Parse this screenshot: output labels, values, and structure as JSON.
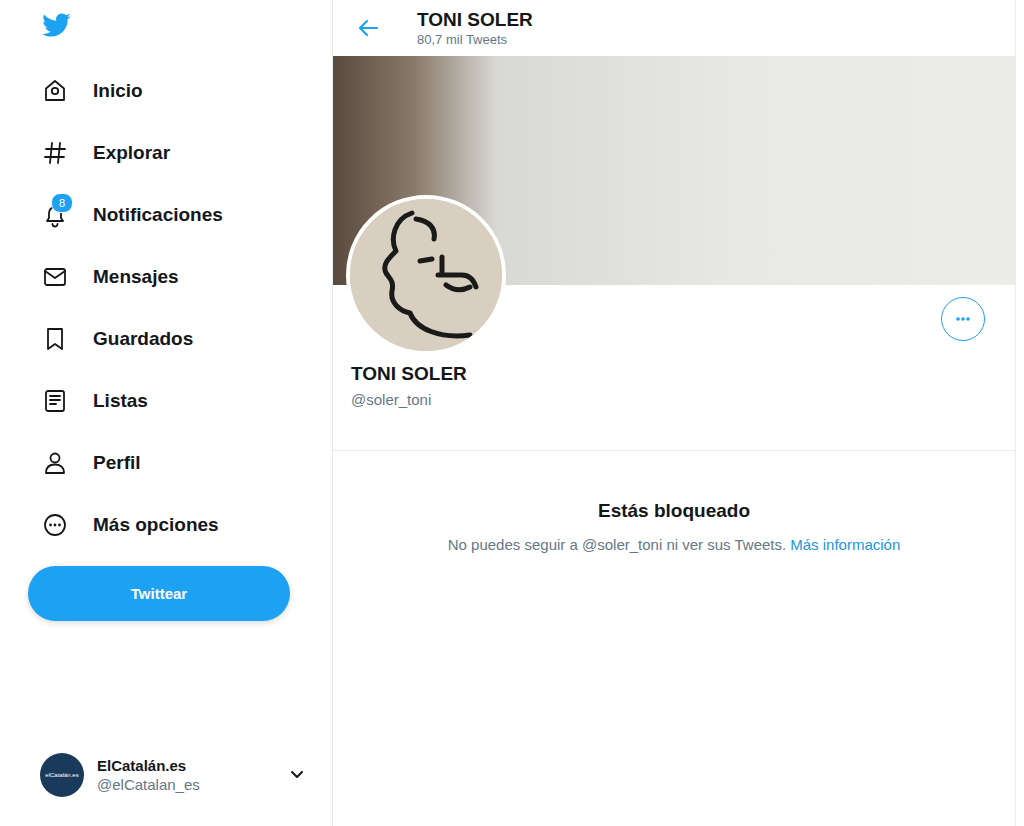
{
  "sidebar": {
    "items": [
      {
        "label": "Inicio"
      },
      {
        "label": "Explorar"
      },
      {
        "label": "Notificaciones",
        "badge": "8"
      },
      {
        "label": "Mensajes"
      },
      {
        "label": "Guardados"
      },
      {
        "label": "Listas"
      },
      {
        "label": "Perfil"
      },
      {
        "label": "Más opciones"
      }
    ],
    "tweet_button": "Twittear",
    "account": {
      "avatar_text": "elCatalán.es",
      "name": "ElCatalán.es",
      "handle": "@elCatalan_es"
    }
  },
  "header": {
    "name": "TONI SOLER",
    "tweet_count": "80,7 mil Tweets"
  },
  "profile": {
    "name": "TONI SOLER",
    "handle": "@soler_toni"
  },
  "blocked": {
    "title": "Estás bloqueado",
    "message": "No puedes seguir a @soler_toni ni ver sus Tweets.",
    "link": "Más información"
  }
}
